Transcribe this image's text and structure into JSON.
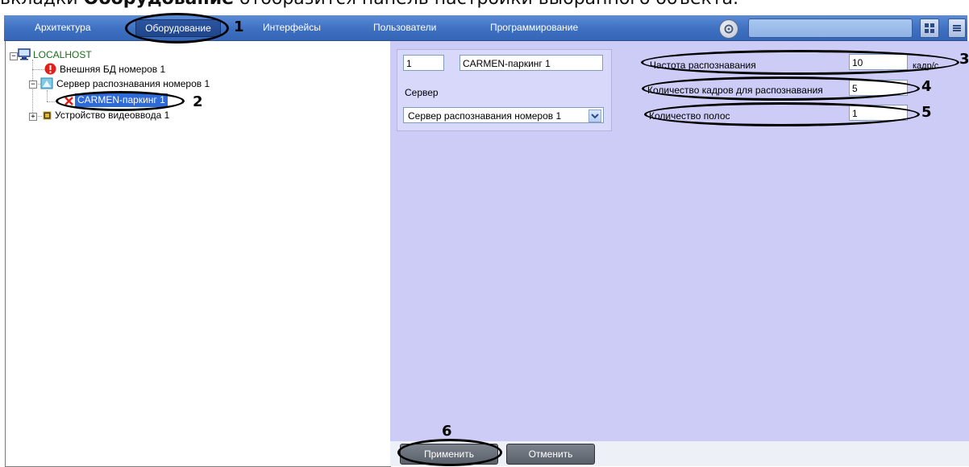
{
  "doc": {
    "prefix": "вкладки ",
    "bold": "Оборудование",
    "suffix": " отобразится панель настройки выбранного объекта."
  },
  "tabs": [
    "Архитектура",
    "Оборудование",
    "Интерфейсы",
    "Пользователи",
    "Программирование"
  ],
  "tree": {
    "root": "LOCALHOST",
    "items": [
      "Внешняя БД номеров 1",
      "Сервер распознавания номеров 1",
      "CARMEN-паркинг 1",
      "Устройство видеоввода 1"
    ]
  },
  "form": {
    "id_value": "1",
    "name_value": "CARMEN-паркинг 1",
    "server_label": "Сервер",
    "server_value": "Сервер распознавания номеров 1",
    "rate_label": "Частота распознавания",
    "rate_value": "10",
    "rate_unit": "кадр/с",
    "frames_label": "Количество кадров для распознавания",
    "frames_value": "5",
    "lanes_label": "Количество полос",
    "lanes_value": "1"
  },
  "buttons": {
    "apply": "Применить",
    "cancel": "Отменить"
  },
  "callouts": [
    "1",
    "2",
    "3",
    "4",
    "5",
    "6"
  ],
  "colors": {
    "topbar": "#3e70c2",
    "panel": "#ccccf7",
    "error": "#e0201c"
  },
  "icons": [
    "search-icon",
    "layout-grid-icon",
    "menu-icon",
    "computer-icon",
    "error-icon",
    "network-server-icon",
    "delete-x-icon",
    "chip-icon",
    "chevron-down-icon"
  ]
}
